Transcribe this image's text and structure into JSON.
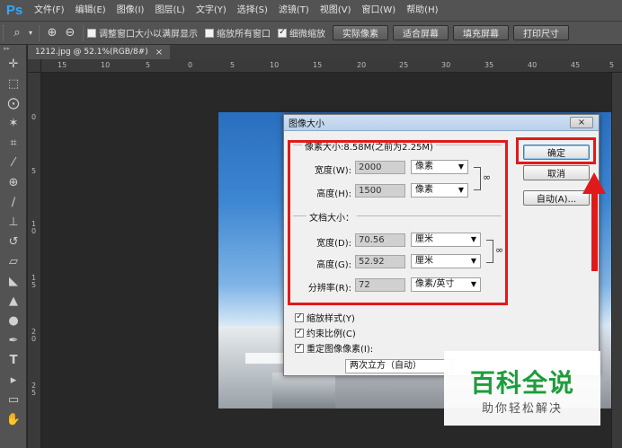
{
  "app": {
    "logo": "Ps"
  },
  "menubar": {
    "items": [
      "文件(F)",
      "编辑(E)",
      "图像(I)",
      "图层(L)",
      "文字(Y)",
      "选择(S)",
      "滤镜(T)",
      "视图(V)",
      "窗口(W)",
      "帮助(H)"
    ]
  },
  "options": {
    "resize_windows_label": "调整窗口大小以满屏显示",
    "zoom_all_label": "缩放所有窗口",
    "scrubby_zoom_label": "细微缩放",
    "actual_pixels": "实际像素",
    "fit_screen": "适合屏幕",
    "fill_screen": "填充屏幕",
    "print_size": "打印尺寸"
  },
  "document": {
    "tab_label": "1212.jpg @ 52.1%(RGB/8#)",
    "close_glyph": "×"
  },
  "rulers": {
    "horizontal": [
      "15",
      "10",
      "5",
      "0",
      "5",
      "10",
      "15",
      "20",
      "25",
      "30",
      "35",
      "40",
      "45",
      "5"
    ],
    "vertical": [
      "0",
      "5",
      "1\n0",
      "1\n5",
      "2\n0",
      "2\n5"
    ]
  },
  "dialog": {
    "title": "图像大小",
    "close_glyph": "×",
    "pixel_group_label": "像素大小:8.58M(之前为2.25M)",
    "width_px_label": "宽度(W):",
    "width_px_value": "2000",
    "width_px_unit": "像素",
    "height_px_label": "高度(H):",
    "height_px_value": "1500",
    "height_px_unit": "像素",
    "doc_group_label": "文档大小：",
    "width_doc_label": "宽度(D):",
    "width_doc_value": "70.56",
    "width_doc_unit": "厘米",
    "height_doc_label": "高度(G):",
    "height_doc_value": "52.92",
    "height_doc_unit": "厘米",
    "resolution_label": "分辨率(R):",
    "resolution_value": "72",
    "resolution_unit": "像素/英寸",
    "ok_button": "确定",
    "cancel_button": "取消",
    "auto_button": "自动(A)...",
    "scale_styles": "缩放样式(Y)",
    "constrain": "约束比例(C)",
    "resample": "重定图像像素(I):",
    "resample_method": "两次立方（自动）"
  },
  "watermark": {
    "main": "百科全说",
    "sub": "助你轻松解决"
  },
  "colors": {
    "annotation_red": "#e01a1a",
    "watermark_green": "#1f9c3d",
    "ps_blue": "#31a8ff"
  }
}
